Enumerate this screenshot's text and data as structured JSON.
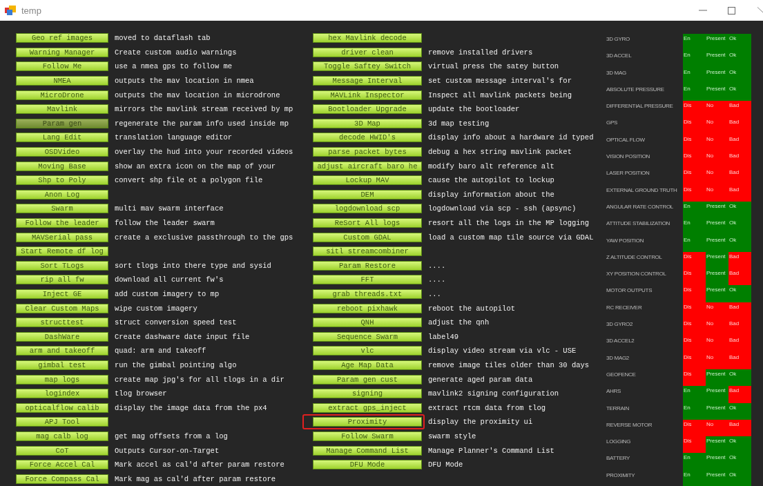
{
  "window": {
    "title": "temp"
  },
  "tools_left": [
    {
      "button": "Geo ref images",
      "description": "moved to dataflash tab",
      "selected": false
    },
    {
      "button": "Warning Manager",
      "description": "Create custom audio warnings",
      "selected": false
    },
    {
      "button": "Follow Me",
      "description": "use a nmea gps to follow me",
      "selected": false
    },
    {
      "button": "NMEA",
      "description": "outputs the mav location in nmea",
      "selected": false
    },
    {
      "button": "MicroDrone",
      "description": "outputs the mav location in microdrone",
      "selected": false
    },
    {
      "button": "Mavlink",
      "description": "mirrors the mavlink stream received by mp",
      "selected": false
    },
    {
      "button": "Param gen",
      "description": "regenerate the param info used inside mp",
      "selected": true
    },
    {
      "button": "Lang Edit",
      "description": "translation language editor",
      "selected": false
    },
    {
      "button": "OSDVideo",
      "description": "overlay the hud into your recorded videos",
      "selected": false
    },
    {
      "button": "Moving Base",
      "description": "show an extra icon on the map of your",
      "selected": false
    },
    {
      "button": "Shp to Poly",
      "description": "convert shp file ot a polygon file",
      "selected": false
    },
    {
      "button": "Anon Log",
      "selected": false
    },
    {
      "button": "Swarm",
      "description": "multi mav swarm interface",
      "selected": false
    },
    {
      "button": "Follow the leader",
      "description": "follow the leader swarm",
      "selected": false
    },
    {
      "button": "MAVSerial pass",
      "description": "create a exclusive passthrough to the gps",
      "selected": false
    },
    {
      "button": "Start Remote df log",
      "selected": false
    },
    {
      "button": "Sort TLogs",
      "description": "sort tlogs into there type and sysid",
      "selected": false
    },
    {
      "button": "rip all fw",
      "description": "download all current fw's",
      "selected": false
    },
    {
      "button": "Inject GE",
      "description": "add custom imagery to mp",
      "selected": false
    },
    {
      "button": "Clear Custom Maps",
      "description": "wipe custom imagery",
      "selected": false
    },
    {
      "button": "structtest",
      "description": "struct conversion speed test",
      "selected": false
    },
    {
      "button": "DashWare",
      "description": "Create dashware date input file",
      "selected": false
    },
    {
      "button": "arm and takeoff",
      "description": "quad: arm and takeoff",
      "selected": false
    },
    {
      "button": "gimbal test",
      "description": "run the gimbal pointing algo",
      "selected": false
    },
    {
      "button": "map logs",
      "description": "create map jpg's for all tlogs in a dir",
      "selected": false
    },
    {
      "button": "logindex",
      "description": "tlog browser",
      "selected": false
    },
    {
      "button": "opticalflow calib",
      "description": "display the image data from the px4",
      "selected": false
    },
    {
      "button": "APJ Tool",
      "selected": false
    },
    {
      "button": "mag calb log",
      "description": "get mag offsets from a log",
      "selected": false
    },
    {
      "button": "CoT",
      "description": "Outputs Cursor-on-Target",
      "selected": false
    },
    {
      "button": "Force Accel Cal",
      "description": "Mark accel as cal'd after param restore",
      "selected": false
    },
    {
      "button": "Force Compass Cal",
      "description": "Mark mag as cal'd after param restore",
      "selected": false
    }
  ],
  "tools_right": [
    {
      "button": "hex Mavlink decode",
      "selected": false,
      "outlined": false
    },
    {
      "button": "driver clean",
      "description": "remove installed drivers",
      "selected": false,
      "outlined": false
    },
    {
      "button": "Toggle Saftey Switch",
      "description": "virtual press the satey button",
      "selected": false,
      "outlined": false
    },
    {
      "button": "Message Interval",
      "description": "set custom message interval's for",
      "selected": false,
      "outlined": false
    },
    {
      "button": "MAVLink Inspector",
      "description": "Inspect all mavlink packets being",
      "selected": false,
      "outlined": false
    },
    {
      "button": "Bootloader Upgrade",
      "description": "update the bootloader",
      "selected": false,
      "outlined": false
    },
    {
      "button": "3D Map",
      "description": "3d map testing",
      "selected": false,
      "outlined": false
    },
    {
      "button": "decode HWID's",
      "description": "display info about a hardware id typed",
      "selected": false,
      "outlined": false
    },
    {
      "button": "parse packet bytes",
      "description": "debug a hex string mavlink packet",
      "selected": false,
      "outlined": false
    },
    {
      "button": "adjust aircraft baro he",
      "description": "modify baro alt reference alt",
      "selected": false,
      "outlined": false
    },
    {
      "button": "Lockup MAV",
      "description": "cause the autopilot to lockup",
      "selected": false,
      "outlined": false
    },
    {
      "button": "DEM",
      "description": "display information about the",
      "selected": false,
      "outlined": false
    },
    {
      "button": "logdownload scp",
      "description": "logdownload via scp - ssh (apsync)",
      "selected": false,
      "outlined": false
    },
    {
      "button": "ReSort All logs",
      "description": "resort all the logs in the MP logging",
      "selected": false,
      "outlined": false
    },
    {
      "button": "Custom GDAL",
      "description": "load a custom map tile source via GDAL",
      "selected": false,
      "outlined": false
    },
    {
      "button": "sitl streamcombiner",
      "selected": false,
      "outlined": false
    },
    {
      "button": "Param Restore",
      "description": "....",
      "selected": false,
      "outlined": false
    },
    {
      "button": "FFT",
      "description": "....",
      "selected": false,
      "outlined": false
    },
    {
      "button": "grab threads.txt",
      "description": "...",
      "selected": false,
      "outlined": false
    },
    {
      "button": "reboot pixhawk",
      "description": "reboot the autopilot",
      "selected": false,
      "outlined": false
    },
    {
      "button": "QNH",
      "description": "adjust the qnh",
      "selected": false,
      "outlined": false
    },
    {
      "button": "Sequence Swarm",
      "description": "label49",
      "selected": false,
      "outlined": false
    },
    {
      "button": "vlc",
      "description": "display video stream via vlc - USE",
      "selected": false,
      "outlined": false
    },
    {
      "button": "Age Map Data",
      "description": "remove image tiles older than 30 days",
      "selected": false,
      "outlined": false
    },
    {
      "button": "Param gen cust",
      "description": "generate aged param data",
      "selected": false,
      "outlined": false
    },
    {
      "button": "signing",
      "description": "mavlink2 signing configuration",
      "selected": false,
      "outlined": false
    },
    {
      "button": "extract gps_inject",
      "description": "extract rtcm data from tlog",
      "selected": false,
      "outlined": false
    },
    {
      "button": "Proximity",
      "description": "display the proximity ui",
      "selected": false,
      "outlined": true
    },
    {
      "button": "Follow Swarm",
      "description": "swarm style",
      "selected": false,
      "outlined": false
    },
    {
      "button": "Manage Command List",
      "description": "Manage Planner's Command List",
      "selected": false,
      "outlined": false
    },
    {
      "button": "DFU Mode",
      "description": "DFU Mode",
      "selected": false,
      "outlined": false
    }
  ],
  "sensors": [
    {
      "name": "3D GYRO",
      "enabled": {
        "text": "En",
        "ok": true
      },
      "present": {
        "text": "Present",
        "ok": true
      },
      "health": {
        "text": "Ok",
        "ok": true
      }
    },
    {
      "name": "3D ACCEL",
      "enabled": {
        "text": "En",
        "ok": true
      },
      "present": {
        "text": "Present",
        "ok": true
      },
      "health": {
        "text": "Ok",
        "ok": true
      }
    },
    {
      "name": "3D MAG",
      "enabled": {
        "text": "En",
        "ok": true
      },
      "present": {
        "text": "Present",
        "ok": true
      },
      "health": {
        "text": "Ok",
        "ok": true
      }
    },
    {
      "name": "ABSOLUTE PRESSURE",
      "enabled": {
        "text": "En",
        "ok": true
      },
      "present": {
        "text": "Present",
        "ok": true
      },
      "health": {
        "text": "Ok",
        "ok": true
      }
    },
    {
      "name": "DIFFERENTIAL PRESSURE",
      "enabled": {
        "text": "Dis",
        "ok": false
      },
      "present": {
        "text": "No",
        "ok": false
      },
      "health": {
        "text": "Bad",
        "ok": false
      }
    },
    {
      "name": "GPS",
      "enabled": {
        "text": "Dis",
        "ok": false
      },
      "present": {
        "text": "No",
        "ok": false
      },
      "health": {
        "text": "Bad",
        "ok": false
      }
    },
    {
      "name": "OPTICAL FLOW",
      "enabled": {
        "text": "Dis",
        "ok": false
      },
      "present": {
        "text": "No",
        "ok": false
      },
      "health": {
        "text": "Bad",
        "ok": false
      }
    },
    {
      "name": "VISION POSITION",
      "enabled": {
        "text": "Dis",
        "ok": false
      },
      "present": {
        "text": "No",
        "ok": false
      },
      "health": {
        "text": "Bad",
        "ok": false
      }
    },
    {
      "name": "LASER POSITION",
      "enabled": {
        "text": "Dis",
        "ok": false
      },
      "present": {
        "text": "No",
        "ok": false
      },
      "health": {
        "text": "Bad",
        "ok": false
      }
    },
    {
      "name": "EXTERNAL GROUND TRUTH",
      "enabled": {
        "text": "Dis",
        "ok": false
      },
      "present": {
        "text": "No",
        "ok": false
      },
      "health": {
        "text": "Bad",
        "ok": false
      }
    },
    {
      "name": "ANGULAR RATE CONTROL",
      "enabled": {
        "text": "En",
        "ok": true
      },
      "present": {
        "text": "Present",
        "ok": true
      },
      "health": {
        "text": "Ok",
        "ok": true
      }
    },
    {
      "name": "ATTITUDE STABILIZATION",
      "enabled": {
        "text": "En",
        "ok": true
      },
      "present": {
        "text": "Present",
        "ok": true
      },
      "health": {
        "text": "Ok",
        "ok": true
      }
    },
    {
      "name": "YAW POSITION",
      "enabled": {
        "text": "En",
        "ok": true
      },
      "present": {
        "text": "Present",
        "ok": true
      },
      "health": {
        "text": "Ok",
        "ok": true
      }
    },
    {
      "name": "Z ALTITUDE CONTROL",
      "enabled": {
        "text": "Dis",
        "ok": false
      },
      "present": {
        "text": "Present",
        "ok": true
      },
      "health": {
        "text": "Bad",
        "ok": false
      }
    },
    {
      "name": "XY POSITION CONTROL",
      "enabled": {
        "text": "Dis",
        "ok": false
      },
      "present": {
        "text": "Present",
        "ok": true
      },
      "health": {
        "text": "Bad",
        "ok": false
      }
    },
    {
      "name": "MOTOR OUTPUTS",
      "enabled": {
        "text": "Dis",
        "ok": false
      },
      "present": {
        "text": "Present",
        "ok": true
      },
      "health": {
        "text": "Ok",
        "ok": true
      }
    },
    {
      "name": "RC RECEIVER",
      "enabled": {
        "text": "Dis",
        "ok": false
      },
      "present": {
        "text": "No",
        "ok": false
      },
      "health": {
        "text": "Bad",
        "ok": false
      }
    },
    {
      "name": "3D GYRO2",
      "enabled": {
        "text": "Dis",
        "ok": false
      },
      "present": {
        "text": "No",
        "ok": false
      },
      "health": {
        "text": "Bad",
        "ok": false
      }
    },
    {
      "name": "3D ACCEL2",
      "enabled": {
        "text": "Dis",
        "ok": false
      },
      "present": {
        "text": "No",
        "ok": false
      },
      "health": {
        "text": "Bad",
        "ok": false
      }
    },
    {
      "name": "3D MAG2",
      "enabled": {
        "text": "Dis",
        "ok": false
      },
      "present": {
        "text": "No",
        "ok": false
      },
      "health": {
        "text": "Bad",
        "ok": false
      }
    },
    {
      "name": "GEOFENCE",
      "enabled": {
        "text": "Dis",
        "ok": false
      },
      "present": {
        "text": "Present",
        "ok": true
      },
      "health": {
        "text": "Ok",
        "ok": true
      }
    },
    {
      "name": "AHRS",
      "enabled": {
        "text": "En",
        "ok": true
      },
      "present": {
        "text": "Present",
        "ok": true
      },
      "health": {
        "text": "Bad",
        "ok": false
      }
    },
    {
      "name": "TERRAIN",
      "enabled": {
        "text": "En",
        "ok": true
      },
      "present": {
        "text": "Present",
        "ok": true
      },
      "health": {
        "text": "Ok",
        "ok": true
      }
    },
    {
      "name": "REVERSE MOTOR",
      "enabled": {
        "text": "Dis",
        "ok": false
      },
      "present": {
        "text": "No",
        "ok": false
      },
      "health": {
        "text": "Bad",
        "ok": false
      }
    },
    {
      "name": "LOGGING",
      "enabled": {
        "text": "Dis",
        "ok": false
      },
      "present": {
        "text": "Present",
        "ok": true
      },
      "health": {
        "text": "Ok",
        "ok": true
      }
    },
    {
      "name": "BATTERY",
      "enabled": {
        "text": "En",
        "ok": true
      },
      "present": {
        "text": "Present",
        "ok": true
      },
      "health": {
        "text": "Ok",
        "ok": true
      }
    },
    {
      "name": "PROXIMITY",
      "enabled": {
        "text": "En",
        "ok": true
      },
      "present": {
        "text": "Present",
        "ok": true
      },
      "health": {
        "text": "Ok",
        "ok": true
      }
    }
  ]
}
